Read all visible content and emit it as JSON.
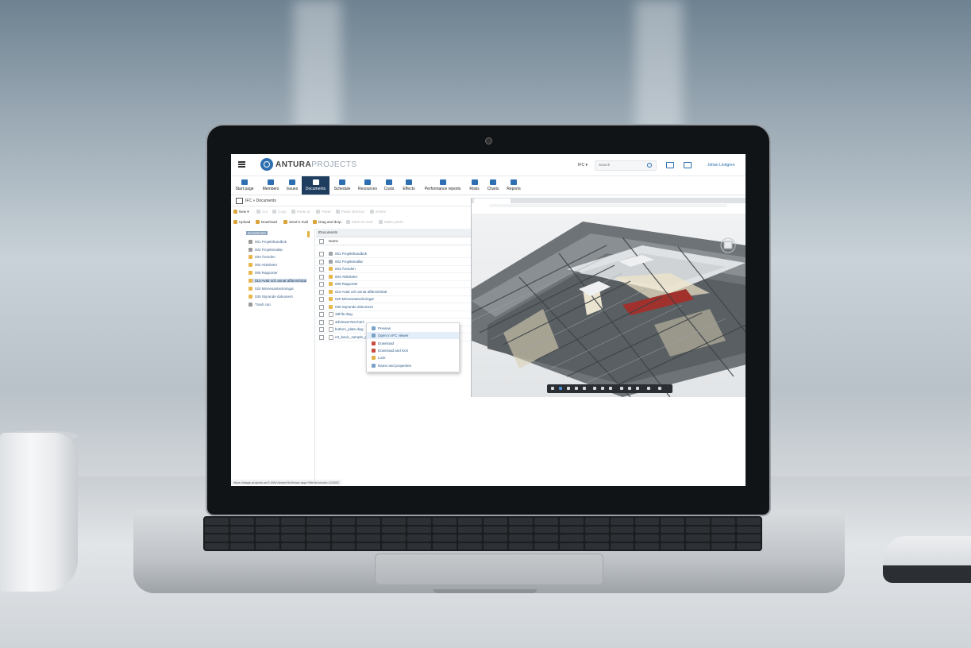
{
  "app": {
    "brand_primary": "ANTURA",
    "brand_secondary": "PROJECTS",
    "accent": "#2d6fb0",
    "nav_active_bg": "#1f3e5f"
  },
  "header": {
    "project": "IFC ▾",
    "search_placeholder": "Search",
    "user": "Johan Lindgren"
  },
  "nav": [
    {
      "label": "Start page",
      "icon": "home-icon"
    },
    {
      "label": "Members",
      "icon": "person-icon"
    },
    {
      "label": "Issues",
      "icon": "clipboard-icon"
    },
    {
      "label": "Documents",
      "icon": "grid-icon",
      "active": true
    },
    {
      "label": "Schedule",
      "icon": "schedule-icon"
    },
    {
      "label": "Resources",
      "icon": "people-icon"
    },
    {
      "label": "Costs",
      "icon": "costs-icon"
    },
    {
      "label": "Effects",
      "icon": "effects-icon"
    },
    {
      "label": "Performance reports",
      "icon": "report-icon"
    },
    {
      "label": "Risks",
      "icon": "risk-icon"
    },
    {
      "label": "Charts",
      "icon": "chart-icon"
    },
    {
      "label": "Reports",
      "icon": "export-icon"
    }
  ],
  "breadcrumb": "IFC » Documents",
  "toolbar1": [
    {
      "label": "New ▾",
      "disabled": false
    },
    {
      "label": "Cut",
      "disabled": true
    },
    {
      "label": "Copy",
      "disabled": true
    },
    {
      "label": "Paste at",
      "disabled": true
    },
    {
      "label": "Paste",
      "disabled": true
    },
    {
      "label": "Paste shortcut",
      "disabled": true
    },
    {
      "label": "Delete",
      "disabled": true
    }
  ],
  "toolbar2": [
    {
      "label": "Upload",
      "disabled": false
    },
    {
      "label": "Download",
      "disabled": false
    },
    {
      "label": "Send e-mail",
      "disabled": false
    },
    {
      "label": "Drag and drop",
      "disabled": false
    },
    {
      "label": "Mark as read",
      "disabled": true
    },
    {
      "label": "Make public",
      "disabled": true
    }
  ],
  "tree": {
    "root": "Documents",
    "items": [
      {
        "label": "001 Projekthandbok",
        "type": "doc"
      },
      {
        "label": "002 Projektmallar",
        "type": "doc"
      },
      {
        "label": "003 Ärenden",
        "type": "folder"
      },
      {
        "label": "004 Aktiviteter",
        "type": "folder"
      },
      {
        "label": "005 Rapporter",
        "type": "folder"
      },
      {
        "label": "010 Avtal och annat affärsinfobal",
        "type": "folder",
        "selected": true
      },
      {
        "label": "020 Minnesanteckningar",
        "type": "folder"
      },
      {
        "label": "030 Styrande dokument",
        "type": "folder"
      },
      {
        "label": "Trash can",
        "type": "trash"
      }
    ]
  },
  "grid": {
    "title": "IDocuments",
    "column_name": "Name",
    "rows": [
      {
        "label": "001 Projekthandbok",
        "type": "grey"
      },
      {
        "label": "002 Projektmallar",
        "type": "grey"
      },
      {
        "label": "003 Ärenden",
        "type": "folder"
      },
      {
        "label": "004 Aktiviteter",
        "type": "folder"
      },
      {
        "label": "005 Rapporter",
        "type": "folder"
      },
      {
        "label": "010 Avtal och annat affärsinfobal",
        "type": "folder"
      },
      {
        "label": "020 Minnesanteckningar",
        "type": "folder"
      },
      {
        "label": "030 Styrande dokument",
        "type": "folder"
      },
      {
        "label": "3dFile.dwg",
        "type": "doc"
      },
      {
        "label": "3dViewerTest.html",
        "type": "doc"
      },
      {
        "label": "bottom_plate.dwg",
        "type": "doc"
      },
      {
        "label": "rst_basic_sample_p",
        "type": "doc"
      }
    ]
  },
  "context_menu": [
    {
      "label": "Preview"
    },
    {
      "label": "Open in IFC viewer",
      "highlighted": true
    },
    {
      "label": "Download"
    },
    {
      "label": "Download and lock"
    },
    {
      "label": "Lock"
    },
    {
      "label": "Name and properties"
    }
  ],
  "status_url": "https://stage.projects.se/3.0/IfcViewer/IfcViewer.aspx?fileVersionId=124362"
}
